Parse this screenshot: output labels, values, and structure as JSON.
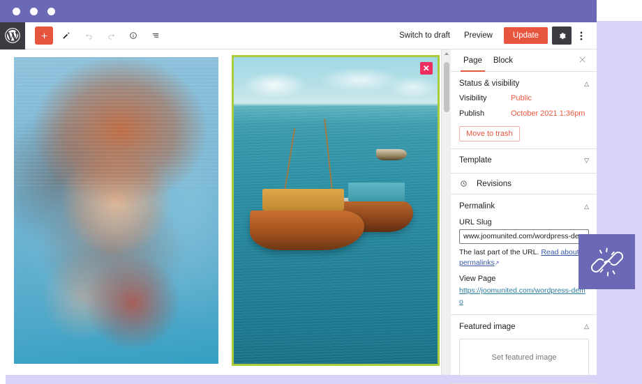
{
  "window": {
    "title_dots": 3,
    "chrome_color": "#6b68b5",
    "accent_color": "#d9d4f7"
  },
  "header": {
    "logo_icon": "wordpress-logo-icon",
    "tools_left": [
      {
        "icon": "add-block-icon",
        "label": "Add block"
      },
      {
        "icon": "edit-pencil-icon",
        "label": "Tools"
      },
      {
        "icon": "undo-icon",
        "label": "Undo"
      },
      {
        "icon": "redo-icon",
        "label": "Redo"
      },
      {
        "icon": "info-icon",
        "label": "Details"
      },
      {
        "icon": "list-view-icon",
        "label": "List view"
      }
    ],
    "switch_to_draft": "Switch to draft",
    "preview": "Preview",
    "update": "Update",
    "settings_icon": "gear-icon",
    "more_icon": "kebab-menu-icon",
    "update_color": "#e8553f"
  },
  "canvas": {
    "blocks": [
      {
        "name": "underwater-portrait-image",
        "selected": false,
        "alt": "Underwater portrait of a woman with flowing hair"
      },
      {
        "name": "boats-on-sea-image",
        "selected": true,
        "alt": "Two wooden boats on turquoise ocean water",
        "close_icon": "close-icon",
        "selection_color": "#a9cd3a",
        "close_color": "#ec2f60"
      }
    ]
  },
  "sidebar": {
    "tabs": [
      {
        "label": "Page",
        "active": true
      },
      {
        "label": "Block",
        "active": false
      }
    ],
    "close_icon": "close-icon",
    "status_panel": {
      "title": "Status &  visibility",
      "chevron": "chevron-up-icon",
      "rows": [
        {
          "label": "Visibility",
          "value": "Public"
        },
        {
          "label": "Publish",
          "value": "October 2021 1:36pm"
        }
      ],
      "trash_label": "Move to trash",
      "accent_color": "#e8553f"
    },
    "template_panel": {
      "title": "Template",
      "chevron": "chevron-down-icon"
    },
    "revisions_panel": {
      "icon": "revisions-clock-icon",
      "label": "Revisions"
    },
    "permalink_panel": {
      "title": "Permalink",
      "chevron": "chevron-up-icon",
      "slug_label": "URL Slug",
      "slug_value": "www.joomunited.com/wordpress-demo",
      "slug_placeholder": "wordpress-demo",
      "help_prefix": "The last part of the URL.",
      "help_link": "Read about permalinks",
      "external_icon": "external-link-icon",
      "view_label": "View Page",
      "view_url": "https://joomunited.com/wordpress-demo"
    },
    "featured_panel": {
      "title": "Featured image",
      "chevron": "chevron-up-icon",
      "placeholder": "Set featured image"
    }
  },
  "badge": {
    "icon": "chain-link-icon",
    "background": "#6b68b5"
  }
}
